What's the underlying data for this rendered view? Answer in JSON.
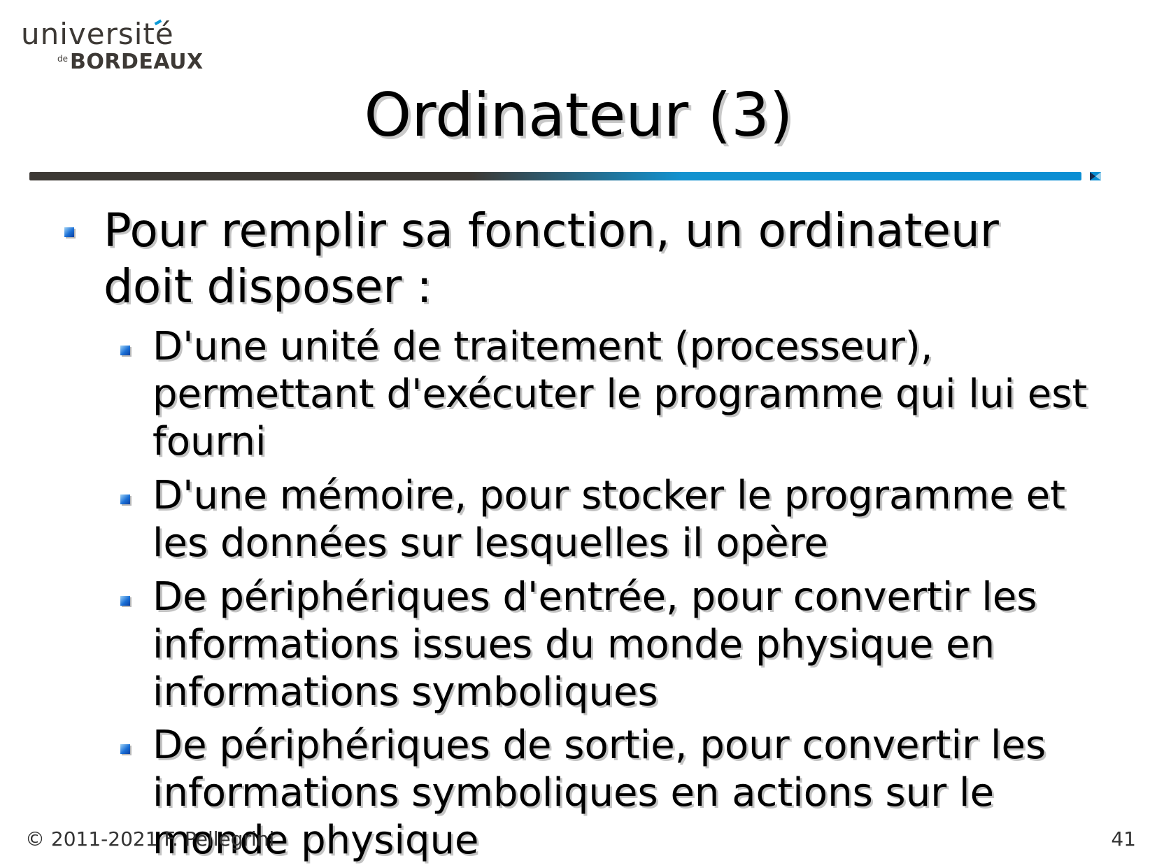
{
  "logo": {
    "top": "université",
    "de": "de",
    "bottom": "BORDEAUX"
  },
  "slide": {
    "title": "Ordinateur (3)",
    "main_bullet": "Pour remplir sa fonction, un ordinateur doit disposer :",
    "sub_bullets": [
      "D'une unité de traitement (processeur), permettant d'exécuter le programme qui lui est fourni",
      "D'une mémoire, pour stocker le programme et les données sur lesquelles il opère",
      "De périphériques d'entrée, pour convertir les informations issues du monde physique en informations symboliques",
      "De périphériques de sortie, pour convertir les informations symboliques en actions sur le monde physique"
    ]
  },
  "footer": {
    "copyright": "© 2011-2021 F. Pellegrini",
    "page_number": "41"
  },
  "colors": {
    "accent_blue": "#0b8ed3",
    "dark_brown": "#3d3935"
  }
}
